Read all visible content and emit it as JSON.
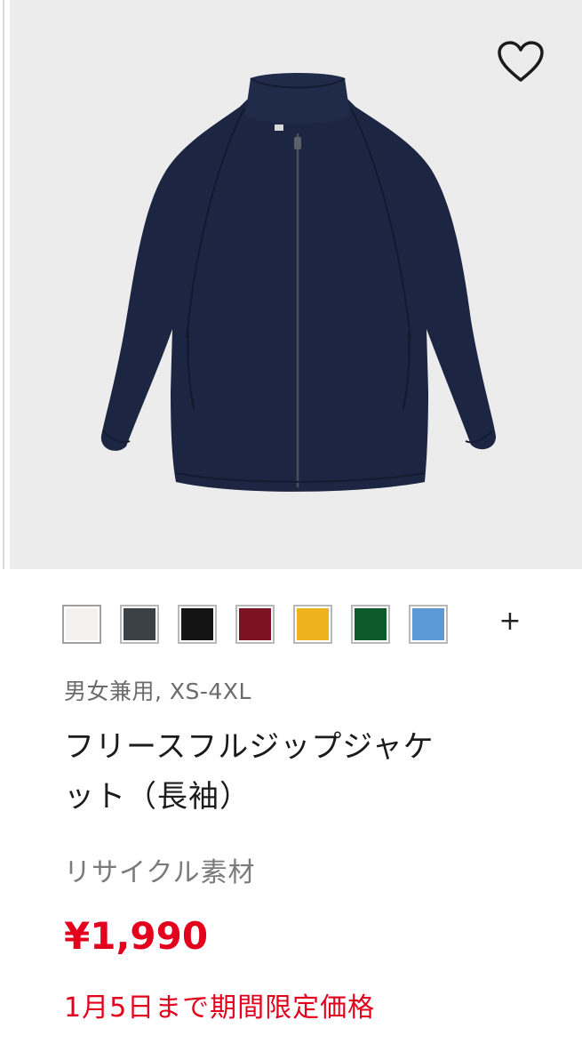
{
  "product": {
    "gender_size": "男女兼用, XS-4XL",
    "name_line1": "フリースフルジップジャケ",
    "name_line2": "ット（長袖）",
    "material": "リサイクル素材",
    "price": "¥1,990",
    "promo": "1月5日まで期間限定価格"
  },
  "favorite": {
    "icon": "heart-outline-icon"
  },
  "colors": {
    "swatches": [
      {
        "name": "off-white",
        "hex": "#f4f2ef"
      },
      {
        "name": "dark-gray",
        "hex": "#3a4147"
      },
      {
        "name": "black",
        "hex": "#141414"
      },
      {
        "name": "wine",
        "hex": "#7d1322"
      },
      {
        "name": "yellow",
        "hex": "#f0b21c"
      },
      {
        "name": "green",
        "hex": "#0f5a2b"
      },
      {
        "name": "blue",
        "hex": "#5c98d6"
      }
    ],
    "more_label": "+"
  },
  "theme": {
    "price_red": "#e3001c",
    "product_navy": "#1c2642"
  }
}
